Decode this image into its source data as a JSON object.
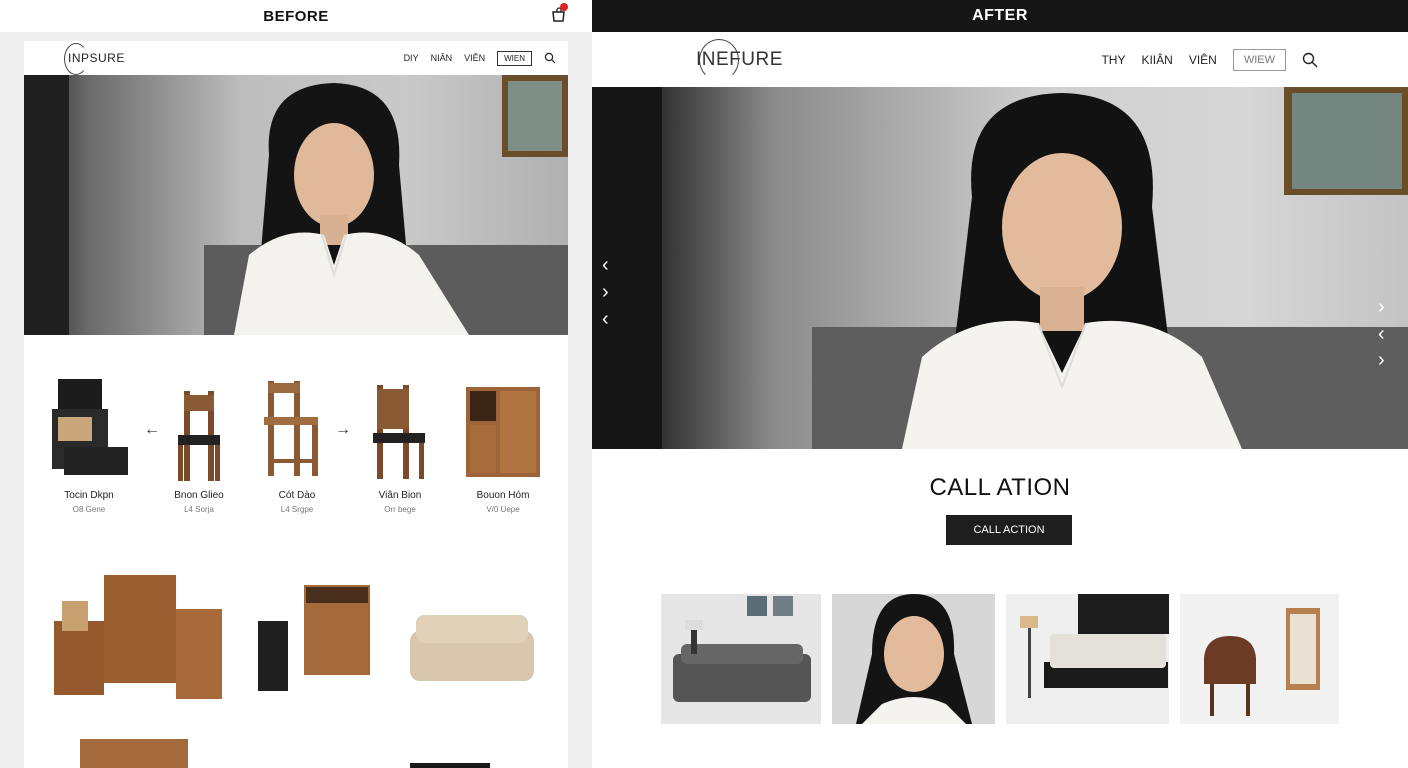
{
  "before": {
    "label": "BEFORE",
    "logo": "INPSURE",
    "nav": [
      "DIY",
      "NIÂN",
      "VIÊN"
    ],
    "nav_button": "WIEN",
    "products": [
      {
        "name": "Tocin Dkpn",
        "sub": "O8 Gene"
      },
      {
        "name": "Bnon Glieo",
        "sub": "L4 Sorja"
      },
      {
        "name": "Cót Dào",
        "sub": "L4 Srgpe"
      },
      {
        "name": "Viân Bion",
        "sub": "Orr bege"
      },
      {
        "name": "Bouon Hóm",
        "sub": "V/0 Uepe"
      }
    ]
  },
  "after": {
    "label": "AFTER",
    "logo": "INEFURE",
    "nav": [
      "THY",
      "KIIÂN",
      "VIÊN"
    ],
    "nav_button": "WIEW",
    "cta_title": "CALL ATION",
    "cta_button": "CALL ACTION"
  },
  "icons": [
    "cart-icon",
    "search-icon",
    "chevron-left-icon",
    "chevron-right-icon",
    "arrow-left-icon",
    "arrow-right-icon"
  ],
  "colors": {
    "dark_bar": "#161616",
    "cta_button": "#1e1e1e",
    "badge": "#e02020",
    "wood": "#8a5a34"
  }
}
